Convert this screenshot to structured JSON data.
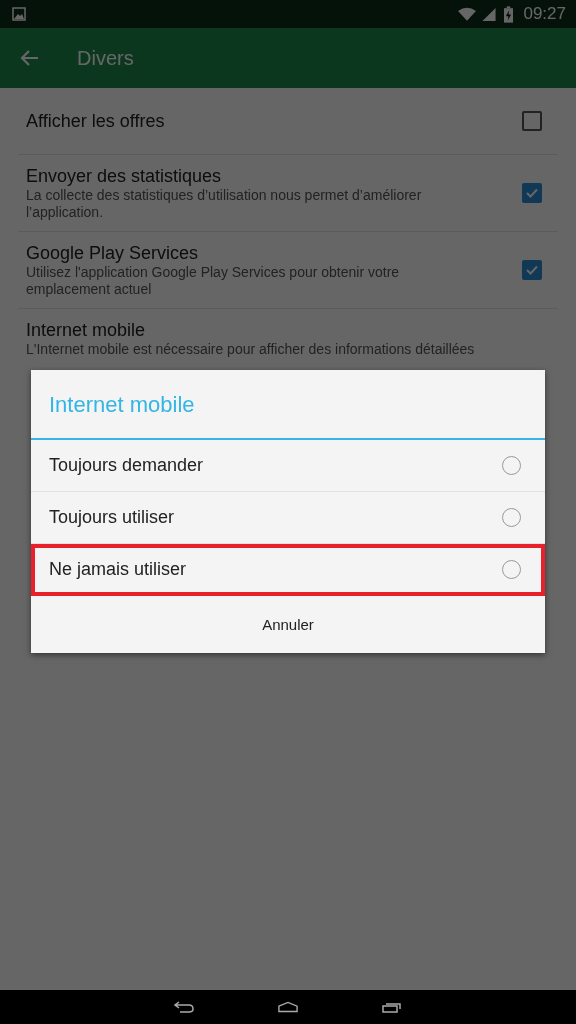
{
  "status_bar": {
    "time": "09:27"
  },
  "toolbar": {
    "title": "Divers"
  },
  "settings": [
    {
      "title": "Afficher les offres",
      "checked": false,
      "kind": "checkbox"
    },
    {
      "title": "Envoyer des statistiques",
      "summary": "La collecte des statistiques d’utilisation nous permet d’améliorer l’application.",
      "checked": true,
      "kind": "checkbox"
    },
    {
      "title": "Google Play Services",
      "summary": "Utilisez l'application Google Play Services pour obtenir votre emplacement actuel",
      "checked": true,
      "kind": "checkbox"
    },
    {
      "title": "Internet mobile",
      "summary": "L'Internet mobile est nécessaire pour afficher des informations détaillées",
      "kind": "plain"
    }
  ],
  "dialog": {
    "title": "Internet mobile",
    "options": [
      {
        "label": "Toujours demander",
        "selected": false,
        "highlighted": false
      },
      {
        "label": "Toujours utiliser",
        "selected": false,
        "highlighted": false
      },
      {
        "label": "Ne jamais utiliser",
        "selected": false,
        "highlighted": true
      }
    ],
    "cancel": "Annuler"
  }
}
